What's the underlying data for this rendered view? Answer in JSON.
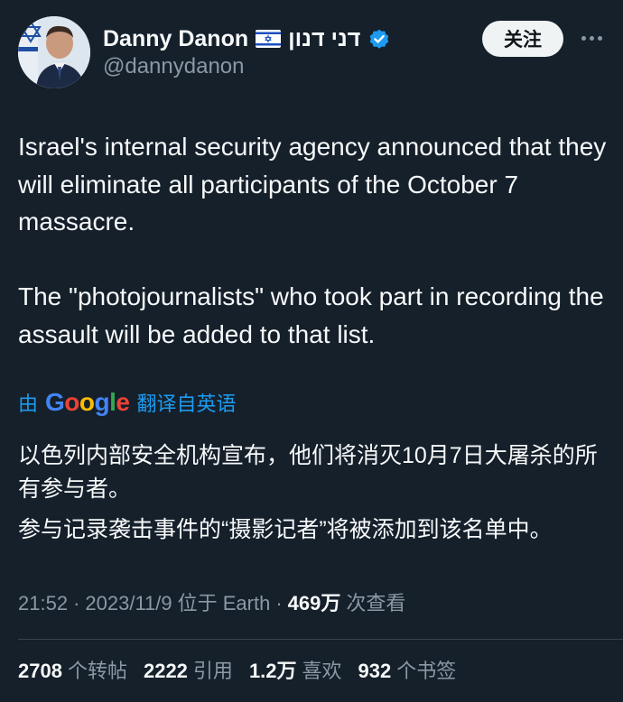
{
  "author": {
    "display_name": "Danny Danon",
    "flag_icon": "israel-flag-icon",
    "hebrew_name": "דני דנון",
    "verified_icon": "verified-badge-icon",
    "handle": "@dannydanon"
  },
  "follow_label": "关注",
  "more_icon": "more-dots-icon",
  "tweet": {
    "paragraphs": [
      "Israel's internal security agency announced that they will eliminate all participants of the October 7 massacre.",
      "The \"photojournalists\" who took part in recording the assault will be added to that list."
    ]
  },
  "translation": {
    "prefix": "由",
    "google_letters": [
      "G",
      "o",
      "o",
      "g",
      "l",
      "e"
    ],
    "suffix": "翻译自英语",
    "paragraphs": [
      "以色列内部安全机构宣布，他们将消灭10月7日大屠杀的所有参与者。",
      "参与记录袭击事件的“摄影记者”将被添加到该名单中。"
    ]
  },
  "meta": {
    "time": "21:52",
    "sep1": "·",
    "date": "2023/11/9",
    "location": "位于 Earth",
    "sep2": "·",
    "views_count": "469万",
    "views_label": "次查看"
  },
  "stats": [
    {
      "count": "2708",
      "label": "个转帖"
    },
    {
      "count": "2222",
      "label": "引用"
    },
    {
      "count": "1.2万",
      "label": "喜欢"
    },
    {
      "count": "932",
      "label": "个书签"
    }
  ],
  "colors": {
    "background": "#15202b",
    "accent": "#1d9bf0",
    "text_primary": "#f7f9f9",
    "text_secondary": "#8b98a5"
  }
}
